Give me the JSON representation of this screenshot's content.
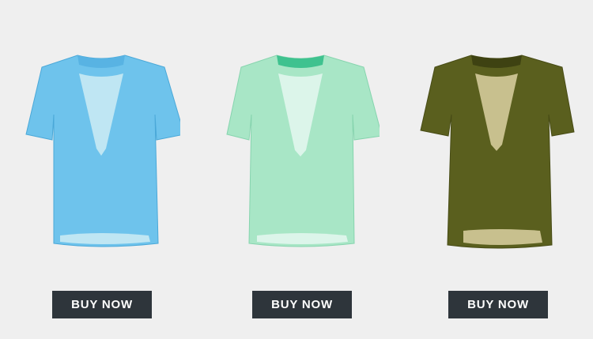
{
  "products": [
    {
      "image": "light-blue-short-sleeve-running-tshirt",
      "colors": {
        "body": "#6ec3ec",
        "body_dark": "#4aa8d8",
        "mesh": "#bfe6f3",
        "collar": "#58b3e3"
      },
      "button_label": "BUY NOW"
    },
    {
      "image": "mint-green-short-sleeve-running-tshirt",
      "colors": {
        "body": "#a8e6c6",
        "body_dark": "#86d4ae",
        "mesh": "#dcf5ea",
        "collar": "#3fc28f"
      },
      "button_label": "BUY NOW"
    },
    {
      "image": "olive-green-short-sleeve-running-tshirt",
      "colors": {
        "body": "#5a5f1e",
        "body_dark": "#474b15",
        "mesh": "#c8c08e",
        "collar": "#3e4212"
      },
      "button_label": "BUY NOW"
    }
  ],
  "button_color": "#2e353b",
  "background_color": "#efefef"
}
